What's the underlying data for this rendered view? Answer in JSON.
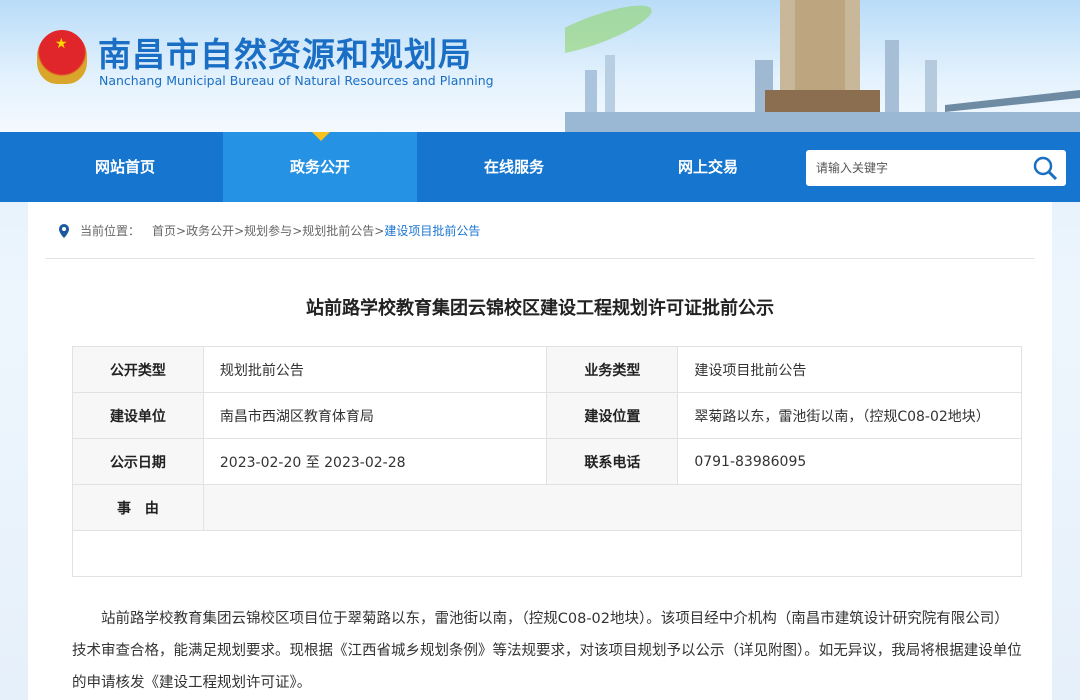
{
  "header": {
    "title": "南昌市自然资源和规划局",
    "subtitle": "Nanchang Municipal Bureau of Natural Resources and Planning"
  },
  "nav": {
    "items": [
      {
        "label": "网站首页"
      },
      {
        "label": "政务公开"
      },
      {
        "label": "在线服务"
      },
      {
        "label": "网上交易"
      }
    ],
    "active": 1,
    "search_placeholder": "请输入关键字"
  },
  "breadcrumb": {
    "label": "当前位置：",
    "items": [
      "首页",
      ">",
      "政务公开",
      ">",
      "规划参与",
      ">",
      "规划批前公告",
      ">",
      "建设项目批前公告"
    ]
  },
  "article": {
    "title": "站前路学校教育集团云锦校区建设工程规划许可证批前公示",
    "table": [
      [
        "公开类型",
        "规划批前公告",
        "业务类型",
        "建设项目批前公告"
      ],
      [
        "建设单位",
        "南昌市西湖区教育体育局",
        "建设位置",
        "翠菊路以东，雷池街以南，（控规C08-02地块）"
      ],
      [
        "公示日期",
        "2023-02-20 至 2023-02-28",
        "联系电话",
        "0791-83986095"
      ]
    ],
    "reason_label": "事　由",
    "body": "站前路学校教育集团云锦校区项目位于翠菊路以东，雷池街以南，（控规C08-02地块）。该项目经中介机构（南昌市建筑设计研究院有限公司）技术审查合格，能满足规划要求。现根据《江西省城乡规划条例》等法规要求，对该项目规划予以公示（详见附图）。如无异议，我局将根据建设单位的申请核发《建设工程规划许可证》。"
  }
}
